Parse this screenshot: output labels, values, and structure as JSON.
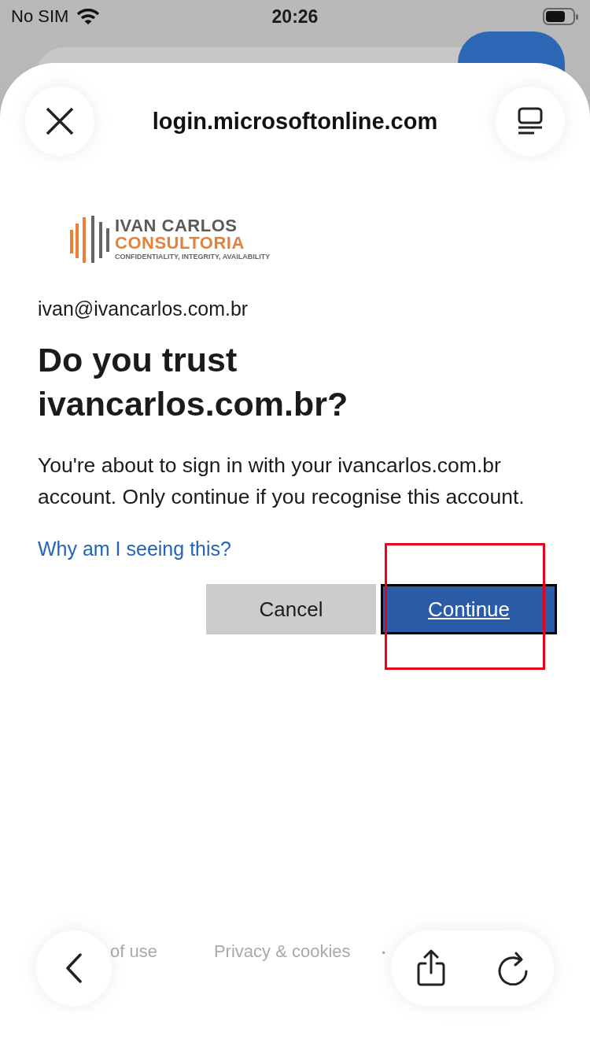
{
  "status_bar": {
    "carrier": "No SIM",
    "time": "20:26"
  },
  "header": {
    "title": "login.microsoftonline.com"
  },
  "logo": {
    "name": "IVAN CARLOS",
    "subtitle": "CONSULTORIA",
    "tagline": "CONFIDENTIALITY, INTEGRITY, AVAILABILITY"
  },
  "account": "ivan@ivancarlos.com.br",
  "heading": "Do you trust ivancarlos.com.br?",
  "message": "You're about to sign in with your ivancarlos.com.br account. Only continue if you recognise this account.",
  "help_link": "Why am I seeing this?",
  "buttons": [
    {
      "label": "Cancel",
      "kind": "secondary"
    },
    {
      "label": "Continue",
      "kind": "primary"
    }
  ],
  "footer": {
    "links": [
      "of use",
      "Privacy & cookies"
    ],
    "separator": "•"
  }
}
